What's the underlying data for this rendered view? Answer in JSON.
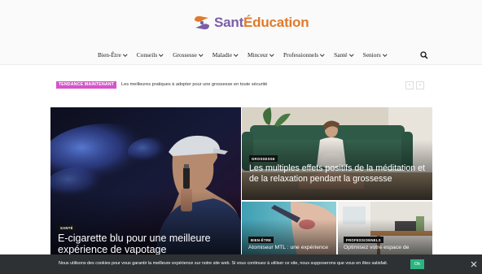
{
  "brand": {
    "name_part1": "Sant",
    "name_part2": "Éducation",
    "purple": "#7b5ea7",
    "orange": "#e07a2b"
  },
  "nav": {
    "items": [
      {
        "label": "Bien-Être"
      },
      {
        "label": "Conseils"
      },
      {
        "label": "Grossesse"
      },
      {
        "label": "Maladie"
      },
      {
        "label": "Minceur"
      },
      {
        "label": "Professionnels"
      },
      {
        "label": "Santé"
      },
      {
        "label": "Seniors"
      }
    ],
    "search_icon": "search-icon"
  },
  "trending": {
    "badge": "TENDANCE MAINTENANT",
    "headline": "Les meilleures pratiques à adopter pour une grossesse en toute sécurité",
    "badge_color": "#d455c8"
  },
  "articles": {
    "main": {
      "category": "SANTÉ",
      "title": "E-cigarette blu pour une meilleure expérience de vapotage"
    },
    "top": {
      "category": "GROSSESSE",
      "title": "Les multiples effets positifs de la méditation et de la relaxation pendant la grossesse"
    },
    "bottom_left": {
      "category": "BIEN-ÊTRE",
      "title": "Atomiseur MTL : une expérience"
    },
    "bottom_right": {
      "category": "PROFESSIONNELS",
      "title": "Optimisez votre espace de"
    }
  },
  "cookie": {
    "text": "Nous utilisons des cookies pour vous garantir la meilleure expérience sur notre site web. Si vous continuez à utiliser ce site, nous supposerons que vous en êtes satisfait.",
    "ok_label": "Ok",
    "accent": "#2ab580"
  }
}
